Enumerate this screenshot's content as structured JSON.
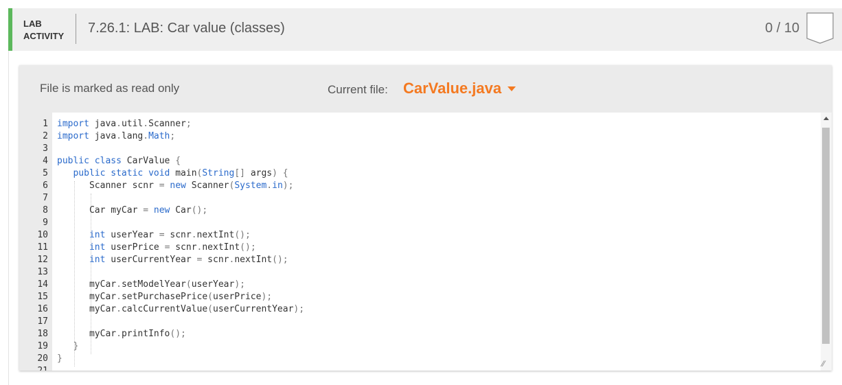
{
  "header": {
    "lab_line1": "LAB",
    "lab_line2": "ACTIVITY",
    "title": "7.26.1: LAB: Car value (classes)",
    "score": "0 / 10",
    "accent_color": "#5cb85c"
  },
  "editor": {
    "readonly_text": "File is marked as read only",
    "current_file_label": "Current file:",
    "current_file": "CarValue.java",
    "file_color": "#f47920",
    "lines": [
      {
        "n": "1",
        "code": "import java.util.Scanner;"
      },
      {
        "n": "2",
        "code": "import java.lang.Math;"
      },
      {
        "n": "3",
        "code": ""
      },
      {
        "n": "4",
        "code": "public class CarValue {"
      },
      {
        "n": "5",
        "code": "   public static void main(String[] args) {"
      },
      {
        "n": "6",
        "code": "      Scanner scnr = new Scanner(System.in);"
      },
      {
        "n": "7",
        "code": ""
      },
      {
        "n": "8",
        "code": "      Car myCar = new Car();"
      },
      {
        "n": "9",
        "code": ""
      },
      {
        "n": "10",
        "code": "      int userYear = scnr.nextInt();"
      },
      {
        "n": "11",
        "code": "      int userPrice = scnr.nextInt();"
      },
      {
        "n": "12",
        "code": "      int userCurrentYear = scnr.nextInt();"
      },
      {
        "n": "13",
        "code": ""
      },
      {
        "n": "14",
        "code": "      myCar.setModelYear(userYear);"
      },
      {
        "n": "15",
        "code": "      myCar.setPurchasePrice(userPrice);"
      },
      {
        "n": "16",
        "code": "      myCar.calcCurrentValue(userCurrentYear);"
      },
      {
        "n": "17",
        "code": ""
      },
      {
        "n": "18",
        "code": "      myCar.printInfo();"
      },
      {
        "n": "19",
        "code": "   }"
      },
      {
        "n": "20",
        "code": "}"
      },
      {
        "n": "21",
        "code": ""
      }
    ]
  }
}
